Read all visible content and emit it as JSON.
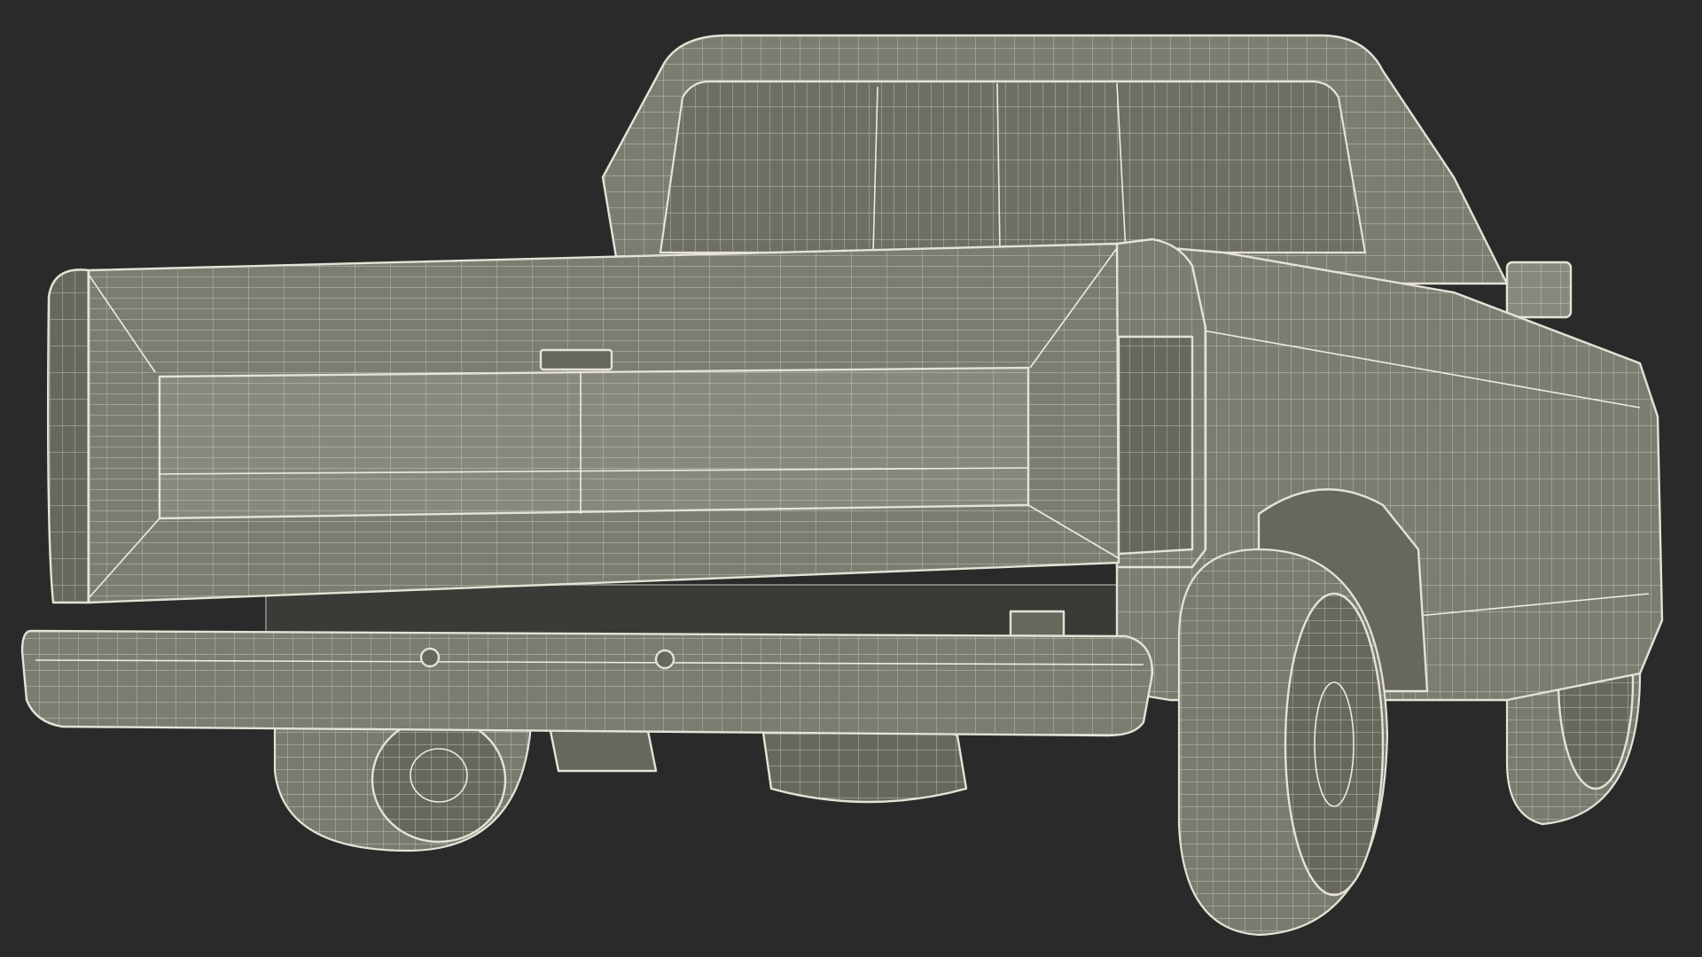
{
  "scene": {
    "subject": "wireframe-pickup-truck-rear-view",
    "colors": {
      "background": "#2a2a2a",
      "surface": "#7c7c72",
      "surface_dark": "#67675e",
      "wire": "#e4e3d6",
      "underside": "#3a3a36"
    }
  }
}
